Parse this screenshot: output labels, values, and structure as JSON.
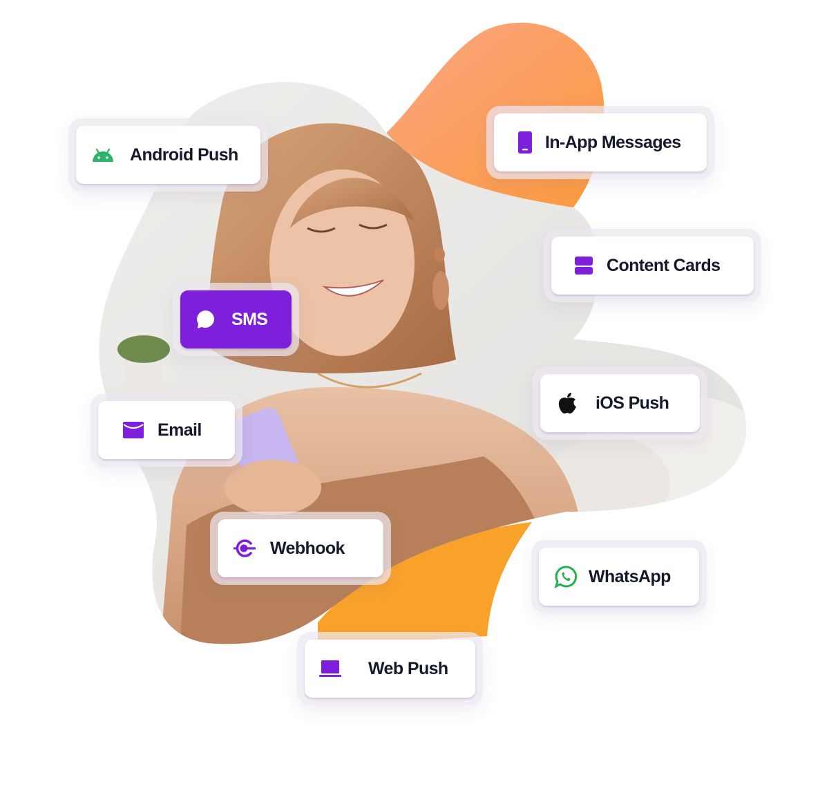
{
  "colors": {
    "accent_purple": "#7e1fdc",
    "android_green": "#2db46a",
    "whatsapp_green": "#25b04d",
    "apple_black": "#111111",
    "text_dark": "#141a2b",
    "orange_top": "#fba586",
    "orange_bottom": "#f9a22a"
  },
  "illustration": {
    "subject": "woman smiling while using a purple phone"
  },
  "channels": [
    {
      "id": "android-push",
      "label": "Android Push",
      "icon": "android-icon",
      "active": false
    },
    {
      "id": "in-app-messages",
      "label": "In-App Messages",
      "icon": "mobile-phone-icon",
      "active": false
    },
    {
      "id": "content-cards",
      "label": "Content Cards",
      "icon": "content-cards-icon",
      "active": false
    },
    {
      "id": "sms",
      "label": "SMS",
      "icon": "chat-bubble-icon",
      "active": true
    },
    {
      "id": "email",
      "label": "Email",
      "icon": "envelope-icon",
      "active": false
    },
    {
      "id": "ios-push",
      "label": "iOS Push",
      "icon": "apple-icon",
      "active": false
    },
    {
      "id": "webhook",
      "label": "Webhook",
      "icon": "webhook-icon",
      "active": false
    },
    {
      "id": "whatsapp",
      "label": "WhatsApp",
      "icon": "whatsapp-icon",
      "active": false
    },
    {
      "id": "web-push",
      "label": "Web Push",
      "icon": "laptop-icon",
      "active": false
    }
  ]
}
